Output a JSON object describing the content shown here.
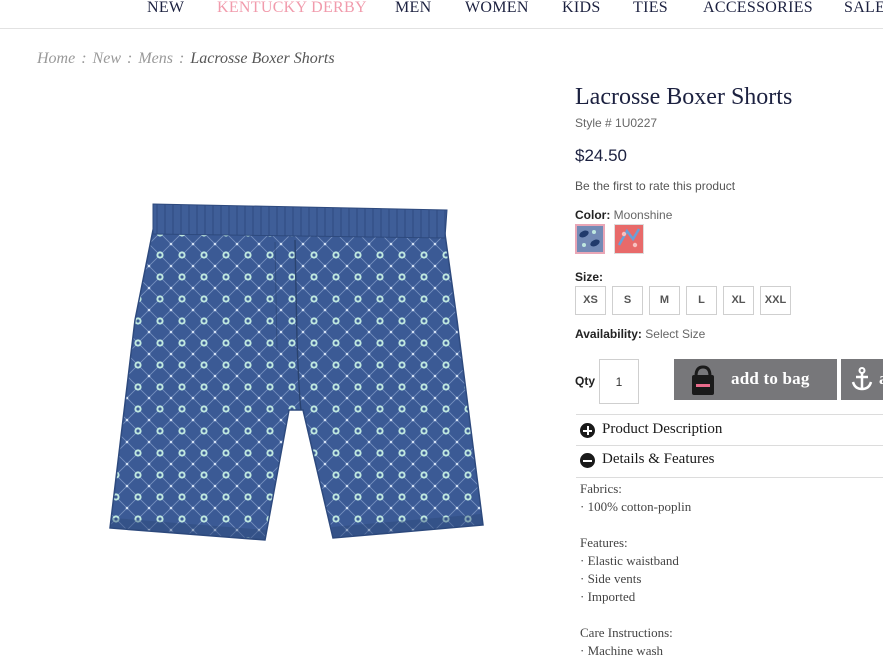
{
  "nav": {
    "items": [
      {
        "label": "NEW"
      },
      {
        "label": "KENTUCKY DERBY"
      },
      {
        "label": "MEN"
      },
      {
        "label": "WOMEN"
      },
      {
        "label": "KIDS"
      },
      {
        "label": "TIES"
      },
      {
        "label": "ACCESSORIES"
      },
      {
        "label": "SALE"
      }
    ]
  },
  "breadcrumb": {
    "items": [
      "Home",
      "New",
      "Mens"
    ],
    "separator": ":",
    "current": "Lacrosse Boxer Shorts"
  },
  "product": {
    "title": "Lacrosse Boxer Shorts",
    "style": "Style # 1U0227",
    "price": "$24.50",
    "rating_text": "Be the first to rate this product",
    "color_label": "Color:",
    "color_value": "Moonshine",
    "swatches": [
      {
        "name": "Moonshine",
        "selected": true,
        "color": "#3b5a95"
      },
      {
        "name": "Pink pattern",
        "selected": false,
        "color": "#e86a6a"
      }
    ],
    "size_label": "Size:",
    "sizes": [
      "XS",
      "S",
      "M",
      "L",
      "XL",
      "XXL"
    ],
    "availability_label": "Availability:",
    "availability_value": "Select Size",
    "qty_label": "Qty",
    "qty_value": "1",
    "add_to_bag_label": "add to bag",
    "anchor_button_label": "a"
  },
  "accordion": {
    "product_description": {
      "label": "Product Description",
      "expanded": false
    },
    "details_features": {
      "label": "Details & Features",
      "expanded": true
    }
  },
  "details": {
    "fabrics_title": "Fabrics:",
    "fabrics": [
      "· 100% cotton-poplin"
    ],
    "features_title": "Features:",
    "features": [
      "· Elastic waistband",
      "· Side vents",
      "· Imported"
    ],
    "care_title": "Care Instructions:",
    "care": [
      "· Machine wash"
    ]
  },
  "colors": {
    "navy": "#1c2140",
    "pink_accent": "#f19bac",
    "button_gray": "#77777a",
    "shorts_blue": "#3b5a95"
  }
}
